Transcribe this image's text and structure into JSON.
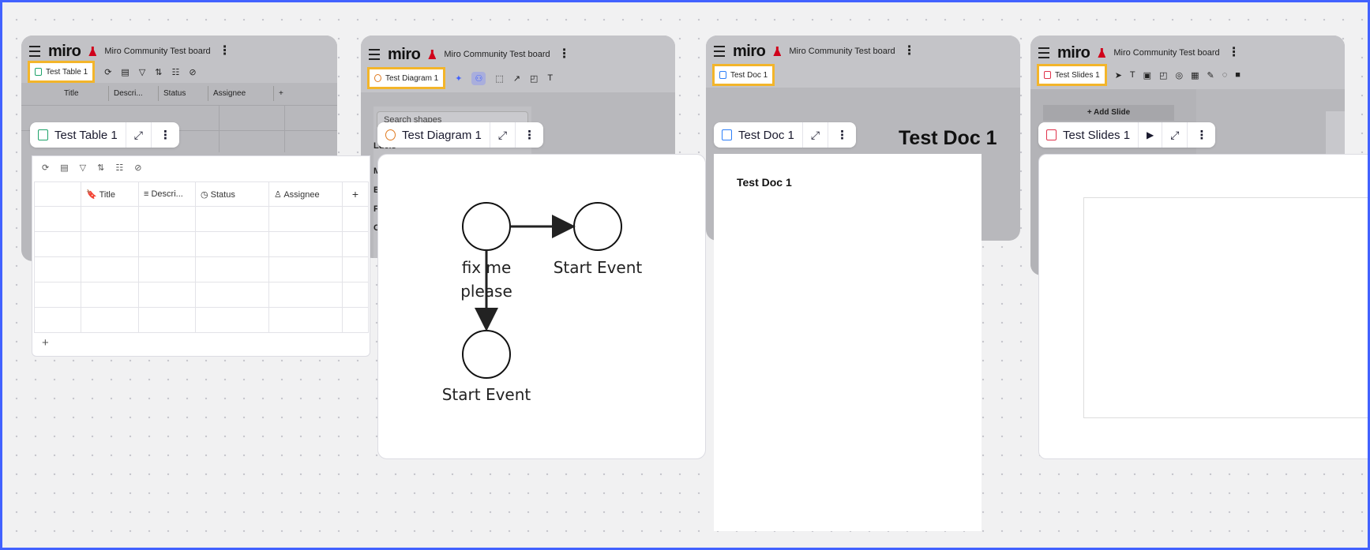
{
  "app": {
    "logo": "miro",
    "board_name": "Miro Community Test board"
  },
  "table_card": {
    "tab_label": "Test Table 1",
    "title": "Test Table 1",
    "columns": [
      "Title",
      "Descri...",
      "Status",
      "Assignee"
    ],
    "add_col": "+",
    "add_row": "+",
    "rows": 5
  },
  "diagram_card": {
    "tab_label": "Test Diagram 1",
    "title": "Test Diagram 1",
    "search_placeholder": "Search shapes",
    "peek_labels": [
      "Lucis",
      "M",
      "B",
      "F",
      "C"
    ],
    "nodes": [
      "fix me please",
      "Start Event",
      "Start Event"
    ],
    "node_line1": "fix me",
    "node_line2": "please",
    "text_tool": "T"
  },
  "doc_card": {
    "tab_label": "Test Doc 1",
    "title": "Test Doc 1",
    "big_heading": "Test Doc 1",
    "body_heading": "Test Doc 1"
  },
  "slides_card": {
    "tab_label": "Test Slides 1",
    "title": "Test Slides 1",
    "add_slide": "+ Add Slide",
    "text_tool": "T"
  },
  "colors": {
    "accent": "#4262ff",
    "highlight": "#f3b52a",
    "table": "#1fa36a",
    "diagram": "#e07a1f",
    "doc": "#2d7ff9",
    "slides": "#e0324b"
  }
}
